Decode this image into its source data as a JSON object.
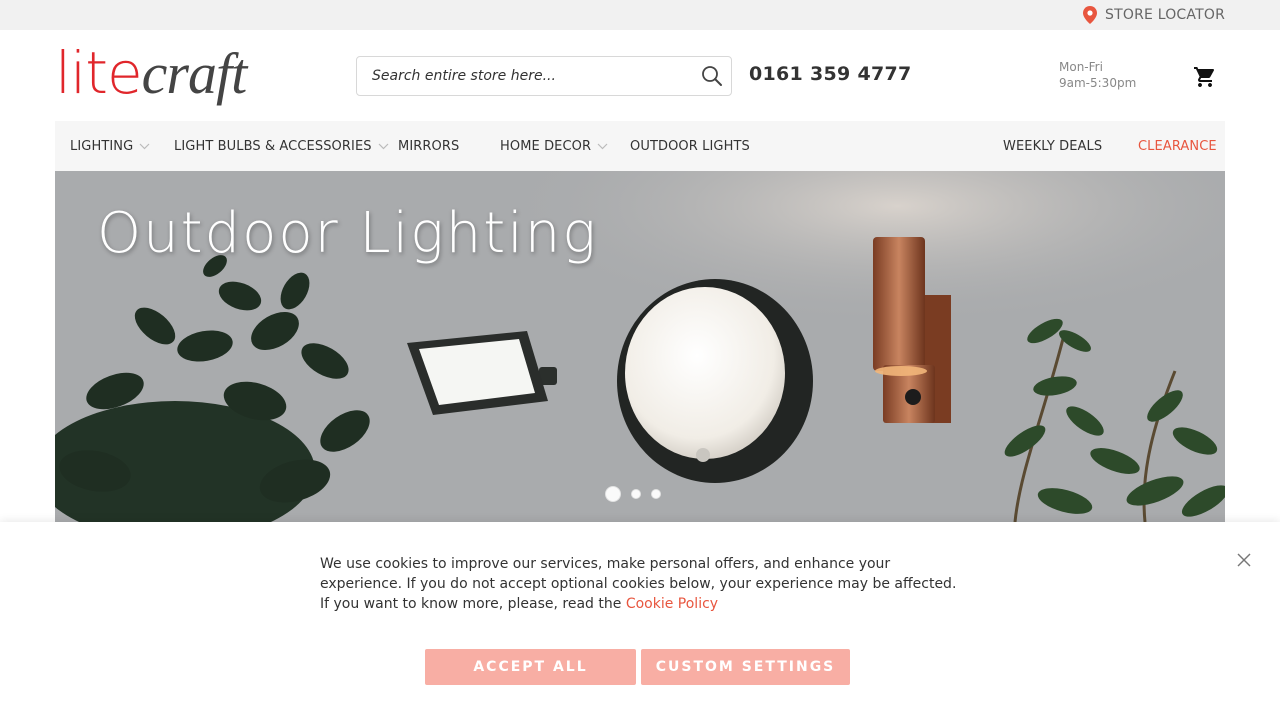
{
  "topbar": {
    "store_locator_label": "STORE LOCATOR"
  },
  "header": {
    "logo_part1": "lite",
    "logo_part2": "craft",
    "search_placeholder": "Search entire store here...",
    "phone": "0161 359 4777",
    "hours_line1": "Mon-Fri",
    "hours_line2": "9am-5:30pm"
  },
  "nav": {
    "items": [
      {
        "label": "LIGHTING",
        "has_dropdown": true
      },
      {
        "label": "LIGHT BULBS & ACCESSORIES",
        "has_dropdown": true
      },
      {
        "label": "MIRRORS",
        "has_dropdown": false
      },
      {
        "label": "HOME DECOR",
        "has_dropdown": true
      },
      {
        "label": "OUTDOOR LIGHTS",
        "has_dropdown": false
      },
      {
        "label": "WEEKLY DEALS",
        "has_dropdown": false
      },
      {
        "label": "CLEARANCE",
        "has_dropdown": false
      }
    ]
  },
  "hero": {
    "title": "Outdoor Lighting",
    "slide_count": 3,
    "active_slide": 1
  },
  "cookie": {
    "text": "We use cookies to improve our services, make personal offers, and enhance your experience. If you do not accept optional cookies below, your experience may be affected. If you want to know more, please, read the ",
    "link_label": "Cookie Policy",
    "accept_label": "ACCEPT ALL",
    "custom_label": "CUSTOM SETTINGS"
  },
  "colors": {
    "brand_red": "#e0262b",
    "accent": "#e8563f",
    "button_bg": "#f8aea4",
    "nav_bg": "#f6f6f6",
    "topbar_bg": "#f1f1f1"
  },
  "icons": [
    "map-pin-icon",
    "search-icon",
    "cart-icon",
    "chevron-down-icon",
    "close-icon"
  ]
}
